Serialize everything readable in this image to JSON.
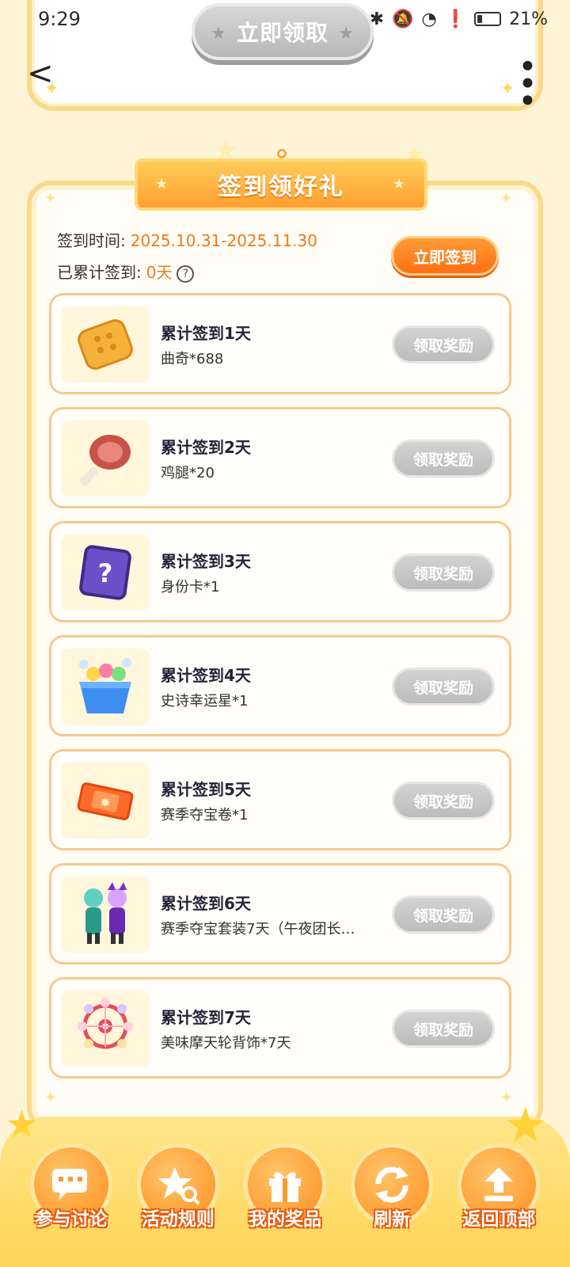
{
  "status": {
    "time": "9:29",
    "battery": "21%"
  },
  "header": {
    "claim_button": "立即领取"
  },
  "panel": {
    "title": "签到领好礼",
    "period_label": "签到时间:",
    "period_value": "2025.10.31-2025.11.30",
    "accum_label": "已累计签到:",
    "accum_value": "0天",
    "signin_button": "立即签到"
  },
  "rewards": [
    {
      "title": "累计签到1天",
      "desc": "曲奇*688",
      "button": "领取奖励",
      "icon": "cookie-icon"
    },
    {
      "title": "累计签到2天",
      "desc": "鸡腿*20",
      "button": "领取奖励",
      "icon": "drumstick-icon"
    },
    {
      "title": "累计签到3天",
      "desc": "身份卡*1",
      "button": "领取奖励",
      "icon": "mystery-card-icon"
    },
    {
      "title": "累计签到4天",
      "desc": "史诗幸运星*1",
      "button": "领取奖励",
      "icon": "lucky-box-icon"
    },
    {
      "title": "累计签到5天",
      "desc": "赛季夺宝卷*1",
      "button": "领取奖励",
      "icon": "ticket-icon"
    },
    {
      "title": "累计签到6天",
      "desc": "赛季夺宝套装7天（午夜团长…",
      "button": "领取奖励",
      "icon": "costume-icon"
    },
    {
      "title": "累计签到7天",
      "desc": "美味摩天轮背饰*7天",
      "button": "领取奖励",
      "icon": "ferris-wheel-icon"
    }
  ],
  "bottom_nav": [
    {
      "label": "参与讨论",
      "icon": "chat-icon"
    },
    {
      "label": "活动规则",
      "icon": "rules-icon"
    },
    {
      "label": "我的奖品",
      "icon": "gift-icon"
    },
    {
      "label": "刷新",
      "icon": "refresh-icon"
    },
    {
      "label": "返回顶部",
      "icon": "upload-icon"
    }
  ]
}
